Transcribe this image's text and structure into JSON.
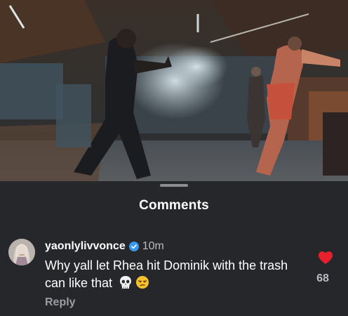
{
  "sheet": {
    "title": "Comments"
  },
  "comment": {
    "username": "yaonlylivvonce",
    "verified_icon": "verified-badge-icon",
    "time": "10m",
    "text": "Why yall let Rhea hit Dominik with the trash can like that",
    "emojis": [
      "skull-emoji",
      "unamused-face-emoji"
    ],
    "reply_label": "Reply",
    "like_icon": "heart-icon",
    "like_count": "68"
  },
  "colors": {
    "sheet_bg": "#25272b",
    "heart": "#e8202e",
    "verified": "#3897f0"
  }
}
